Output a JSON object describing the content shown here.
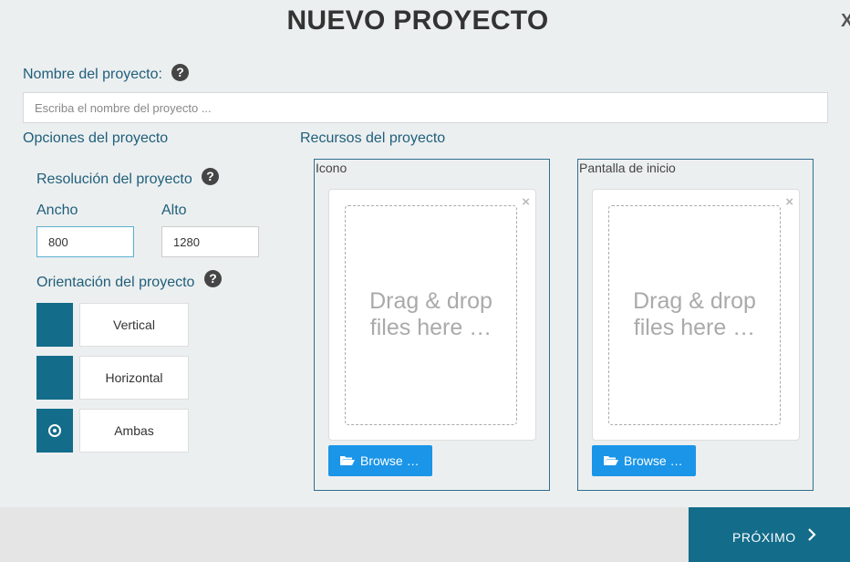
{
  "dialog": {
    "title": "NUEVO PROYECTO",
    "close_label": "X"
  },
  "project_name": {
    "label": "Nombre del proyecto:",
    "placeholder": "Escriba el nombre del proyecto ..."
  },
  "options": {
    "heading": "Opciones del proyecto",
    "resolution_label": "Resolución del proyecto",
    "width_label": "Ancho",
    "width_value": "800",
    "height_label": "Alto",
    "height_value": "1280",
    "orientation_label": "Orientación del proyecto",
    "orientations": [
      {
        "label": "Vertical",
        "selected": false
      },
      {
        "label": "Horizontal",
        "selected": false
      },
      {
        "label": "Ambas",
        "selected": true
      }
    ]
  },
  "resources": {
    "heading": "Recursos del proyecto",
    "panels": [
      {
        "title": "Icono",
        "drop_line1": "Drag & drop",
        "drop_line2": "files here …",
        "browse_label": "Browse …"
      },
      {
        "title": "Pantalla de inicio",
        "drop_line1": "Drag & drop",
        "drop_line2": "files here …",
        "browse_label": "Browse …"
      }
    ]
  },
  "footer": {
    "next_label": "PRÓXIMO"
  },
  "help_icon_glyph": "?",
  "colors": {
    "accent": "#136c8a",
    "browse_button": "#1a95e8",
    "label_text": "#1f5f7a"
  }
}
